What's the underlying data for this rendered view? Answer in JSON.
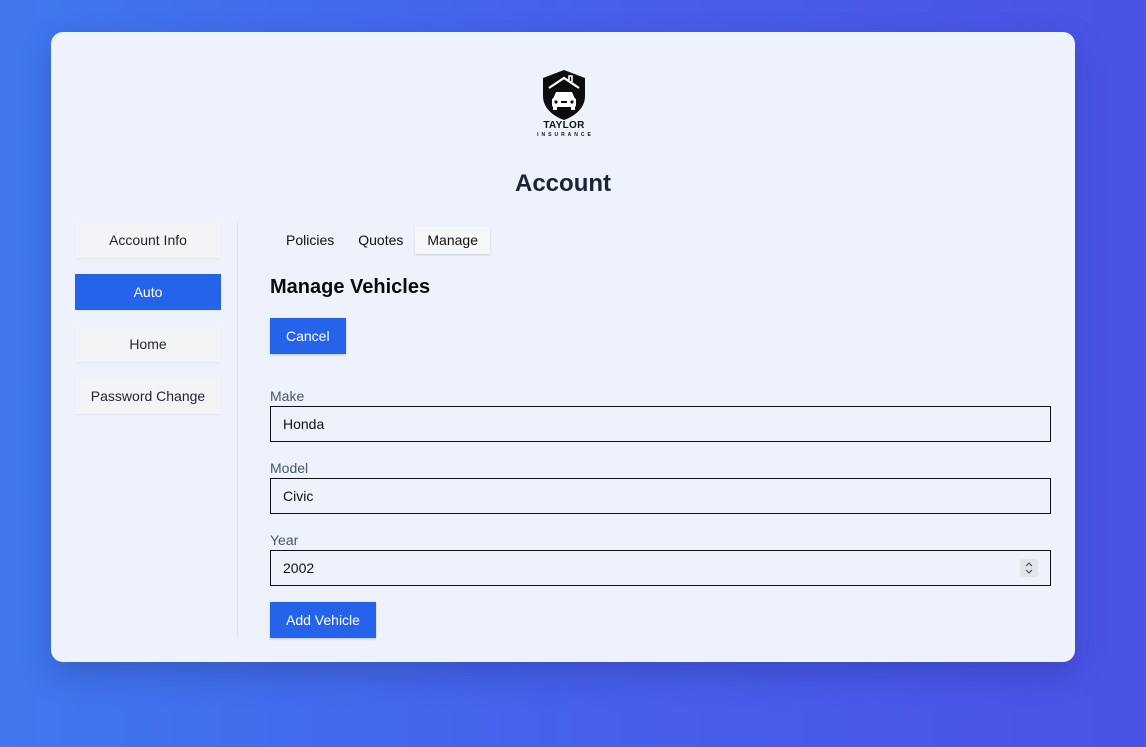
{
  "brand": {
    "name": "TAYLOR",
    "tagline": "INSURANCE"
  },
  "page": {
    "title": "Account"
  },
  "sidebar": {
    "items": [
      {
        "label": "Account Info",
        "active": false
      },
      {
        "label": "Auto",
        "active": true
      },
      {
        "label": "Home",
        "active": false
      },
      {
        "label": "Password Change",
        "active": false
      }
    ]
  },
  "tabs": [
    {
      "label": "Policies",
      "active": false
    },
    {
      "label": "Quotes",
      "active": false
    },
    {
      "label": "Manage",
      "active": true
    }
  ],
  "manage": {
    "title": "Manage Vehicles",
    "cancel_label": "Cancel",
    "make_label": "Make",
    "make_value": "Honda",
    "model_label": "Model",
    "model_value": "Civic",
    "year_label": "Year",
    "year_value": "2002",
    "add_label": "Add Vehicle"
  },
  "colors": {
    "accent": "#2563eb",
    "card": "#edf2fc"
  },
  "icons": {
    "logo": "shield-car-icon",
    "year_spinner": "spinner-arrows-icon"
  }
}
